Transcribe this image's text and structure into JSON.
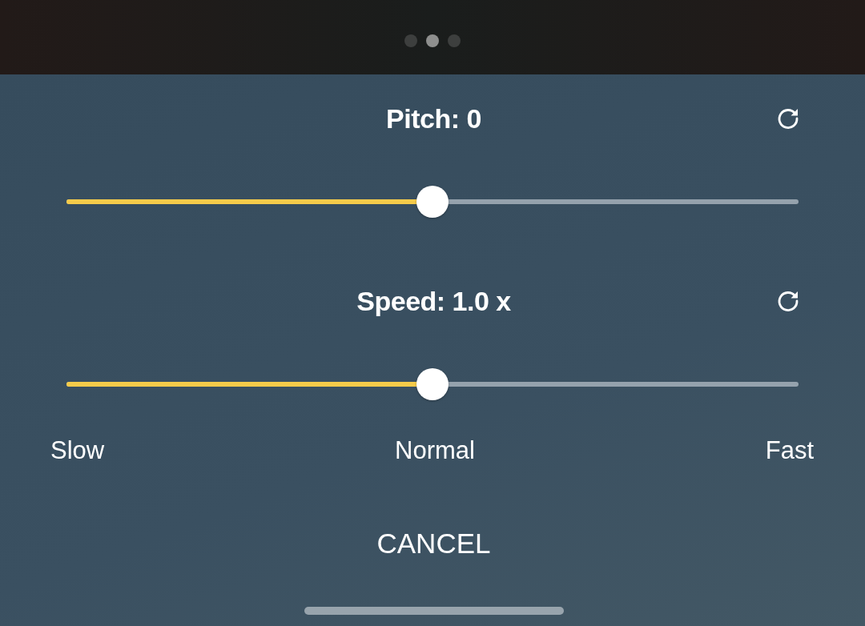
{
  "page_dots": [
    {
      "selected": false
    },
    {
      "selected": true
    },
    {
      "selected": false
    }
  ],
  "sliders": [
    {
      "title": "Pitch: 0",
      "level": 0.5
    },
    {
      "title": "Speed: 1.0 x",
      "level": 0.5
    }
  ],
  "speed_labels": [
    "Slow",
    "Normal",
    "Fast"
  ],
  "cancel_button": "CANCEL"
}
